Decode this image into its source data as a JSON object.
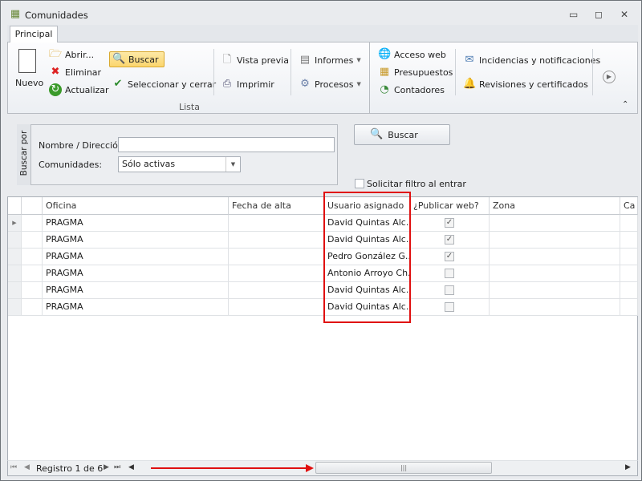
{
  "window": {
    "title": "Comunidades",
    "minimize": "▭",
    "restore": "◻",
    "close": "✕"
  },
  "tabs": [
    {
      "label": "Principal",
      "active": true
    }
  ],
  "ribbon": {
    "nuevo": "Nuevo",
    "abrir": "Abrir...",
    "eliminar": "Eliminar",
    "actualizar": "Actualizar",
    "buscar": "Buscar",
    "seleccionar": "Seleccionar y cerrar",
    "vista_previa": "Vista previa",
    "imprimir": "Imprimir",
    "informes": "Informes",
    "procesos": "Procesos",
    "acceso_web": "Acceso web",
    "presupuestos": "Presupuestos",
    "contadores": "Contadores",
    "incidencias": "Incidencias y notificaciones",
    "revisiones": "Revisiones y certificados",
    "group_lista": "Lista"
  },
  "search": {
    "panel_label": "Buscar por",
    "nombre_label": "Nombre / Dirección:",
    "nombre_value": "",
    "comunidades_label": "Comunidades:",
    "comunidades_value": "Sólo activas",
    "buscar_button": "Buscar",
    "solicitar_filtro": "Solicitar filtro al entrar",
    "solicitar_checked": false
  },
  "grid": {
    "columns": [
      "Oficina",
      "Fecha de alta",
      "Usuario asignado",
      "¿Publicar web?",
      "Zona",
      "Ca"
    ],
    "rows": [
      {
        "oficina": "PRAGMA",
        "fecha": "",
        "usuario": "David Quintas Alc...",
        "publicar": true,
        "zona": ""
      },
      {
        "oficina": "PRAGMA",
        "fecha": "",
        "usuario": "David Quintas Alc...",
        "publicar": true,
        "zona": ""
      },
      {
        "oficina": "PRAGMA",
        "fecha": "",
        "usuario": "Pedro González G...",
        "publicar": true,
        "zona": ""
      },
      {
        "oficina": "PRAGMA",
        "fecha": "",
        "usuario": "Antonio Arroyo Ch...",
        "publicar": false,
        "zona": ""
      },
      {
        "oficina": "PRAGMA",
        "fecha": "",
        "usuario": "David Quintas Alc...",
        "publicar": false,
        "zona": ""
      },
      {
        "oficina": "PRAGMA",
        "fecha": "",
        "usuario": "David Quintas Alc...",
        "publicar": false,
        "zona": ""
      }
    ]
  },
  "footer": {
    "record": "Registro 1 de 6"
  },
  "annotation_color": "#e01010"
}
